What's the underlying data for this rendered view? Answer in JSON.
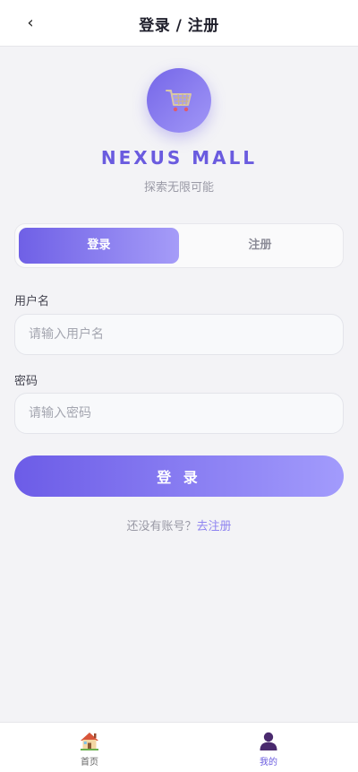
{
  "header": {
    "back_icon": "chevron-left-icon",
    "back_glyph": "‹",
    "title": "登录 / 注册"
  },
  "brand": {
    "logo_icon": "shopping-cart-icon",
    "name": "NEXUS MALL",
    "slogan": "探索无限可能"
  },
  "tabs": [
    {
      "label": "登录",
      "active": true
    },
    {
      "label": "注册",
      "active": false
    }
  ],
  "form": {
    "username": {
      "label": "用户名",
      "placeholder": "请输入用户名",
      "value": ""
    },
    "password": {
      "label": "密码",
      "placeholder": "请输入密码",
      "value": ""
    },
    "submit_label": "登 录"
  },
  "switch_prompt": {
    "text": "还没有账号？",
    "link": "去注册"
  },
  "bottom_nav": [
    {
      "label": "首页",
      "icon": "house-icon",
      "active": false
    },
    {
      "label": "我的",
      "icon": "user-icon",
      "active": true
    }
  ],
  "colors": {
    "accent": "#6c5ce7",
    "accent_light": "#a29bfc",
    "background": "#f3f3f6"
  }
}
